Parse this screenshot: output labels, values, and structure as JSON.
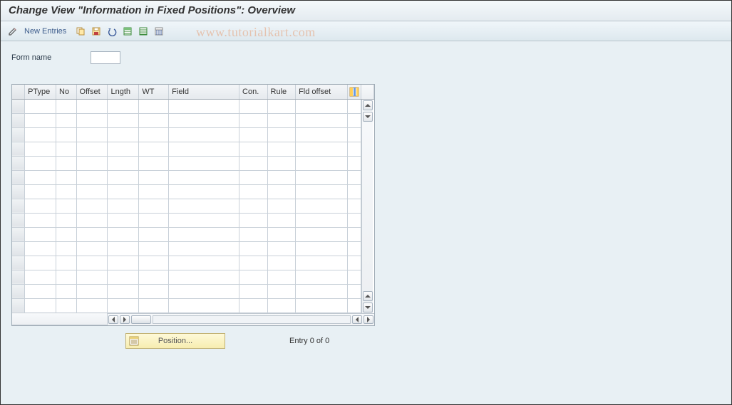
{
  "title": "Change View \"Information in Fixed Positions\": Overview",
  "toolbar": {
    "new_entries_label": "New Entries"
  },
  "watermark": "www.tutorialkart.com",
  "form": {
    "name_label": "Form name",
    "name_value": ""
  },
  "grid": {
    "columns": [
      "PType",
      "No",
      "Offset",
      "Lngth",
      "WT",
      "Field",
      "Con.",
      "Rule",
      "Fld offset"
    ],
    "rows": 15
  },
  "footer": {
    "position_label": "Position...",
    "entry_text": "Entry 0 of 0"
  }
}
